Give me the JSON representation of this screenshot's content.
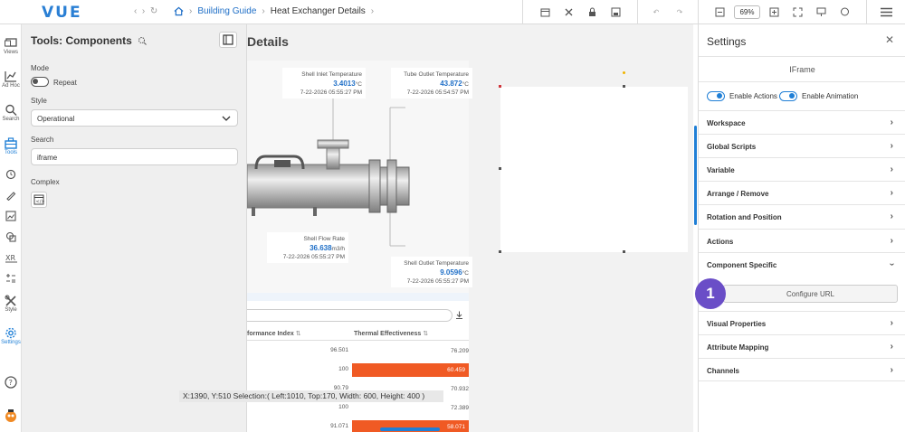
{
  "app": {
    "logo": "VUE"
  },
  "breadcrumb": {
    "home_icon": "home-icon",
    "link": "Building Guide",
    "current": "Heat Exchanger Details"
  },
  "toolbar": {
    "zoom": "69%"
  },
  "leftnav": {
    "items": [
      {
        "label": "Views"
      },
      {
        "label": "Ad Hoc"
      },
      {
        "label": "Search"
      },
      {
        "label": "Tools"
      },
      {
        "label": "Style"
      },
      {
        "label": "Settings"
      }
    ]
  },
  "tools": {
    "title": "Tools: Components",
    "mode_label": "Mode",
    "repeat_label": "Repeat",
    "style_label": "Style",
    "style_value": "Operational",
    "search_label": "Search",
    "search_value": "iframe",
    "complex_label": "Complex"
  },
  "canvas": {
    "title": "Details",
    "cards": [
      {
        "label": "Shell Inlet Temperature",
        "value": "3.4013",
        "unit": "°C",
        "time": "7-22-2026 05:55:27 PM"
      },
      {
        "label": "Tube Outlet Temperature",
        "value": "43.872",
        "unit": "°C",
        "time": "7-22-2026 05:54:57 PM"
      },
      {
        "label": "Shell Flow Rate",
        "value": "36.638",
        "unit": "m3/h",
        "time": "7-22-2026 05:55:27 PM"
      },
      {
        "label": "Shell Outlet Temperature",
        "value": "9.0596",
        "unit": "°C",
        "time": "7-22-2026 05:55:27 PM"
      }
    ],
    "table": {
      "headers": [
        "formance Index",
        "Thermal Effectiveness"
      ],
      "rows": [
        {
          "index": "96.501",
          "eff": "76.209",
          "alert": false
        },
        {
          "index": "100",
          "eff": "60.459",
          "alert": true
        },
        {
          "index": "90.79",
          "eff": "70.932",
          "alert": false
        },
        {
          "index": "100",
          "eff": "72.389",
          "alert": false
        },
        {
          "index": "91.071",
          "eff": "58.071",
          "alert": true
        }
      ]
    },
    "status": "X:1390, Y:510  Selection:( Left:1010, Top:170, Width: 600, Height: 400 )"
  },
  "settings": {
    "title": "Settings",
    "subtitle": "IFrame",
    "enable_actions": "Enable Actions",
    "enable_animation": "Enable Animation",
    "sections": [
      "Workspace",
      "Global Scripts",
      "Variable",
      "Arrange / Remove",
      "Rotation and Position",
      "Actions",
      "Component Specific"
    ],
    "configure_url": "Configure URL",
    "sections_after": [
      "Visual Properties",
      "Attribute Mapping",
      "Channels"
    ]
  },
  "badge": {
    "number": "1"
  },
  "colors": {
    "accent": "#1f7fd6",
    "alert": "#f05a24",
    "badge": "#6a4ec7"
  }
}
